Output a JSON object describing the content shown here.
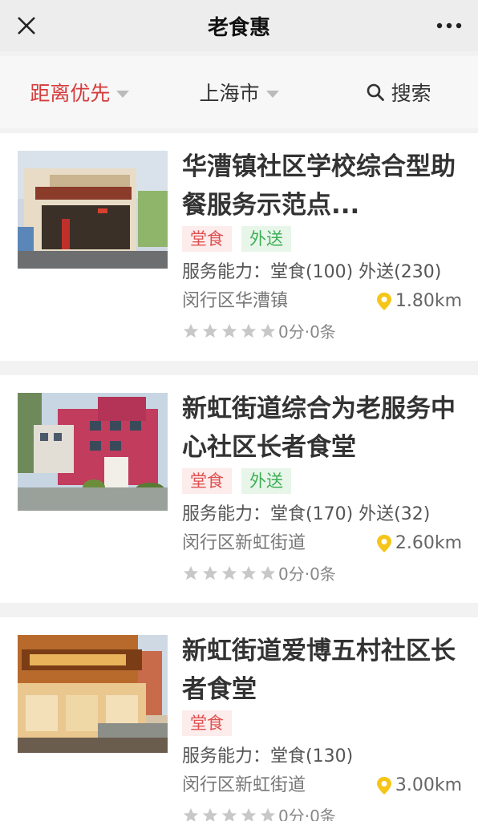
{
  "nav": {
    "title": "老食惠",
    "close_icon": "close-icon",
    "more_icon": "more-dots-icon"
  },
  "filters": {
    "sort_label": "距离优先",
    "city_label": "上海市",
    "search_label": "搜索"
  },
  "colors": {
    "accent_red": "#d63b3b",
    "tag_dine_bg": "#fdecec",
    "tag_deliver_bg": "#e8f6ea",
    "pin_yellow": "#f5c518"
  },
  "listings": [
    {
      "name": "华漕镇社区学校综合型助餐服务示范点...",
      "tags": [
        "堂食",
        "外送"
      ],
      "capacity": "服务能力：堂食(100) 外送(230)",
      "location": "闵行区华漕镇",
      "distance": "1.80km",
      "rating_text": "0分·0条"
    },
    {
      "name": "新虹街道综合为老服务中心社区长者食堂",
      "tags": [
        "堂食",
        "外送"
      ],
      "capacity": "服务能力：堂食(170) 外送(32)",
      "location": "闵行区新虹街道",
      "distance": "2.60km",
      "rating_text": "0分·0条"
    },
    {
      "name": "新虹街道爱博五村社区长者食堂",
      "tags": [
        "堂食"
      ],
      "capacity": "服务能力：堂食(130)",
      "location": "闵行区新虹街道",
      "distance": "3.00km",
      "rating_text": "0分·0条"
    }
  ]
}
